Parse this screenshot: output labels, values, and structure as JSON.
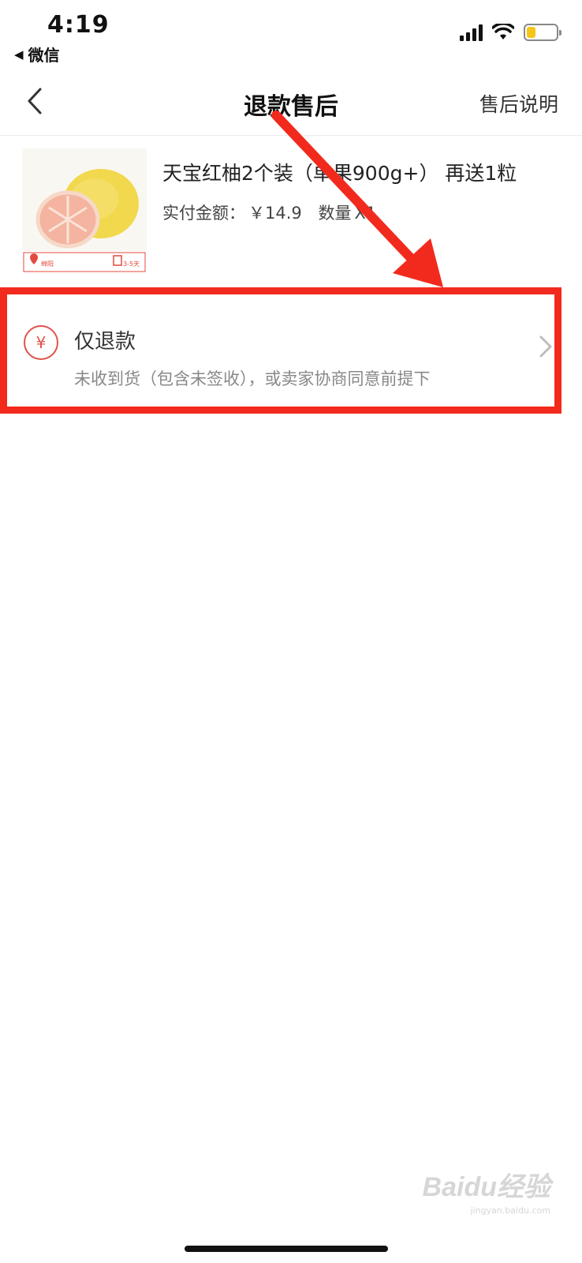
{
  "status_bar": {
    "time": "4:19",
    "back_app": "微信",
    "battery_color": "#f5c518"
  },
  "nav": {
    "title": "退款售后",
    "right_link": "售后说明",
    "back_icon": "chevron-left-icon"
  },
  "product": {
    "name": "天宝红柚2个装（单果900g+） 再送1粒",
    "paid_label": "实付金额：",
    "paid_value": "￥14.9",
    "quantity_label": "数量",
    "quantity_value": "X1",
    "image_tag_left": "绵阳",
    "image_tag_right": "3-5天"
  },
  "refund_option": {
    "icon": "yuan-icon",
    "icon_symbol": "¥",
    "title": "仅退款",
    "description": "未收到货（包含未签收），或卖家协商同意前提下"
  },
  "colors": {
    "highlight": "#f22a1d",
    "accent": "#e0534a"
  },
  "watermark": {
    "main": "Baidu经验",
    "sub": "jingyan.baidu.com"
  }
}
